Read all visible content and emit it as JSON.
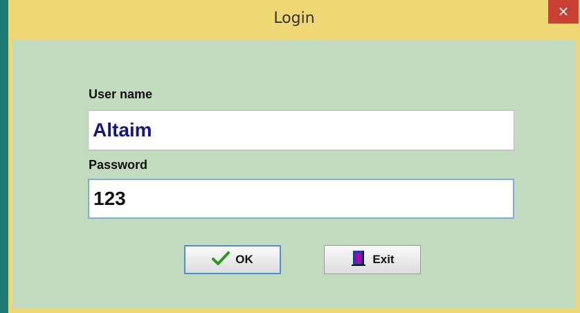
{
  "window": {
    "title": "Login",
    "close_glyph": "×"
  },
  "form": {
    "username_label": "User name",
    "username_value": "Altaim",
    "password_label": "Password",
    "password_value": "123"
  },
  "buttons": {
    "ok_label": "OK",
    "ok_icon": "checkmark-icon",
    "exit_label": "Exit",
    "exit_icon": "exit-door-icon"
  },
  "colors": {
    "titlebar": "#efd873",
    "client": "#c2dbbf",
    "close": "#c94135",
    "username_text": "#17177a",
    "password_text": "#111111",
    "desktop": "#1e7b74"
  }
}
